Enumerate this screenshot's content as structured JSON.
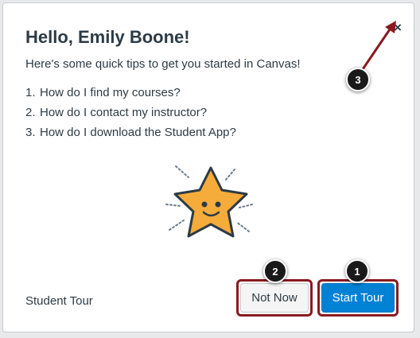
{
  "dialog": {
    "title": "Hello, Emily Boone!",
    "intro": "Here's some quick tips to get you started in Canvas!",
    "tips": [
      {
        "num": "1.",
        "text": "How do I find my courses?"
      },
      {
        "num": "2.",
        "text": "How do I contact my instructor?"
      },
      {
        "num": "3.",
        "text": "How do I download the Student App?"
      }
    ],
    "close_glyph": "×",
    "illustration_icon": "smiling-star-icon"
  },
  "footer": {
    "label": "Student Tour",
    "not_now_label": "Not Now",
    "start_tour_label": "Start Tour"
  },
  "callouts": {
    "start_tour": "1",
    "not_now": "2",
    "close": "3"
  },
  "colors": {
    "primary_button": "#0081d4",
    "highlight": "#8a1a20",
    "star": "#f6ac3b",
    "text": "#2d3b45"
  }
}
